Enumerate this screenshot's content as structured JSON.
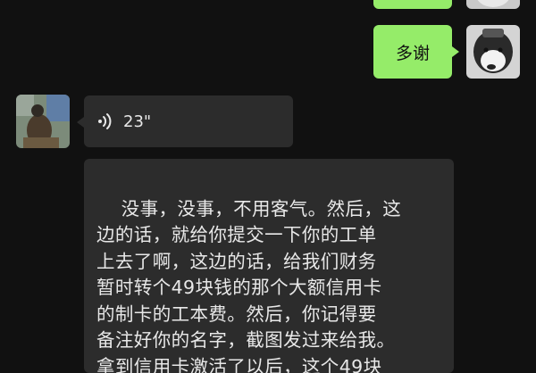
{
  "colors": {
    "background": "#111111",
    "outgoing_bubble": "#95ec69",
    "incoming_bubble": "#2c2c2c",
    "incoming_text": "#e8e8e8"
  },
  "messages": {
    "outgoing_thanks": "多谢",
    "voice": {
      "icon": "voice-wave-icon",
      "duration": "23\""
    },
    "incoming_text": "没事，没事，不用客气。然后，这\n边的话，就给你提交一下你的工单\n上去了啊，这边的话，给我们财务\n暂时转个49块钱的那个大额信用卡\n的制卡的工本费。然后，你记得要\n备注好你的名字，截图发过来给我。\n拿到信用卡激活了以后，这个49块"
  }
}
